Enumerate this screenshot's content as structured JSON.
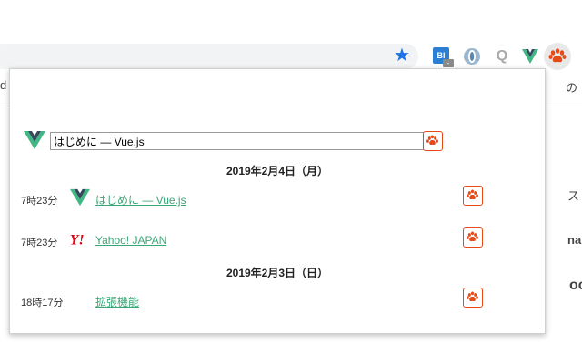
{
  "colors": {
    "accent_paw": "#e64a19",
    "link": "#3aa676",
    "star": "#1a73e8"
  },
  "toolbar": {
    "star_icon": "star-icon",
    "extensions": [
      {
        "name": "bl-extension",
        "label": "Bl",
        "badge": "-"
      },
      {
        "name": "opera-extension",
        "label": ""
      },
      {
        "name": "q-extension",
        "label": "Q"
      },
      {
        "name": "vue-devtools-extension",
        "label": ""
      },
      {
        "name": "paw-extension",
        "label": ""
      }
    ]
  },
  "background": {
    "left_fragment": "d",
    "right_fragments": [
      "の",
      "ス",
      "na",
      "oc"
    ]
  },
  "popup": {
    "search": {
      "value": "はじめに — Vue.js"
    },
    "groups": [
      {
        "date": "2019年2月4日（月）",
        "entries": [
          {
            "time": "7時23分",
            "title": "はじめに — Vue.js",
            "icon": "vue-icon"
          },
          {
            "time": "7時23分",
            "title": "Yahoo! JAPAN",
            "icon": "yahoo-icon"
          }
        ]
      },
      {
        "date": "2019年2月3日（日）",
        "entries": [
          {
            "time": "18時17分",
            "title": "拡張機能",
            "icon": ""
          }
        ]
      }
    ]
  }
}
